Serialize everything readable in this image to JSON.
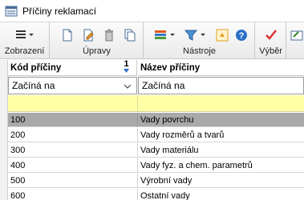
{
  "window": {
    "title": "Příčiny reklamací"
  },
  "ribbon": {
    "groups": [
      {
        "label": "Zobrazení"
      },
      {
        "label": "Úpravy"
      },
      {
        "label": "Nástroje"
      },
      {
        "label": "Výběr"
      }
    ],
    "icons": [
      "list-view-icon",
      "new-record-icon",
      "edit-record-icon",
      "delete-record-icon",
      "copy-record-icon",
      "columns-icon",
      "filter-icon",
      "export-icon",
      "help-icon",
      "select-check-icon",
      "open-icon"
    ]
  },
  "grid": {
    "columns": [
      {
        "label": "Kód příčiny",
        "sort_indicator": "1"
      },
      {
        "label": "Název příčiny"
      }
    ],
    "filters": [
      {
        "value": "Začíná na"
      },
      {
        "value": "Začíná na"
      }
    ],
    "rows": [
      {
        "code": "100",
        "name": "Vady povrchu"
      },
      {
        "code": "200",
        "name": "Vady rozměrů a tvarů"
      },
      {
        "code": "300",
        "name": "Vady materiálu"
      },
      {
        "code": "400",
        "name": "Vady fyz. a chem. parametrů"
      },
      {
        "code": "500",
        "name": "Výrobní vady"
      },
      {
        "code": "600",
        "name": "Ostatní vady"
      }
    ],
    "selected_row_index": 0
  },
  "colors": {
    "new_row": "#ffffa6",
    "selected_row": "#a9a9a9"
  }
}
